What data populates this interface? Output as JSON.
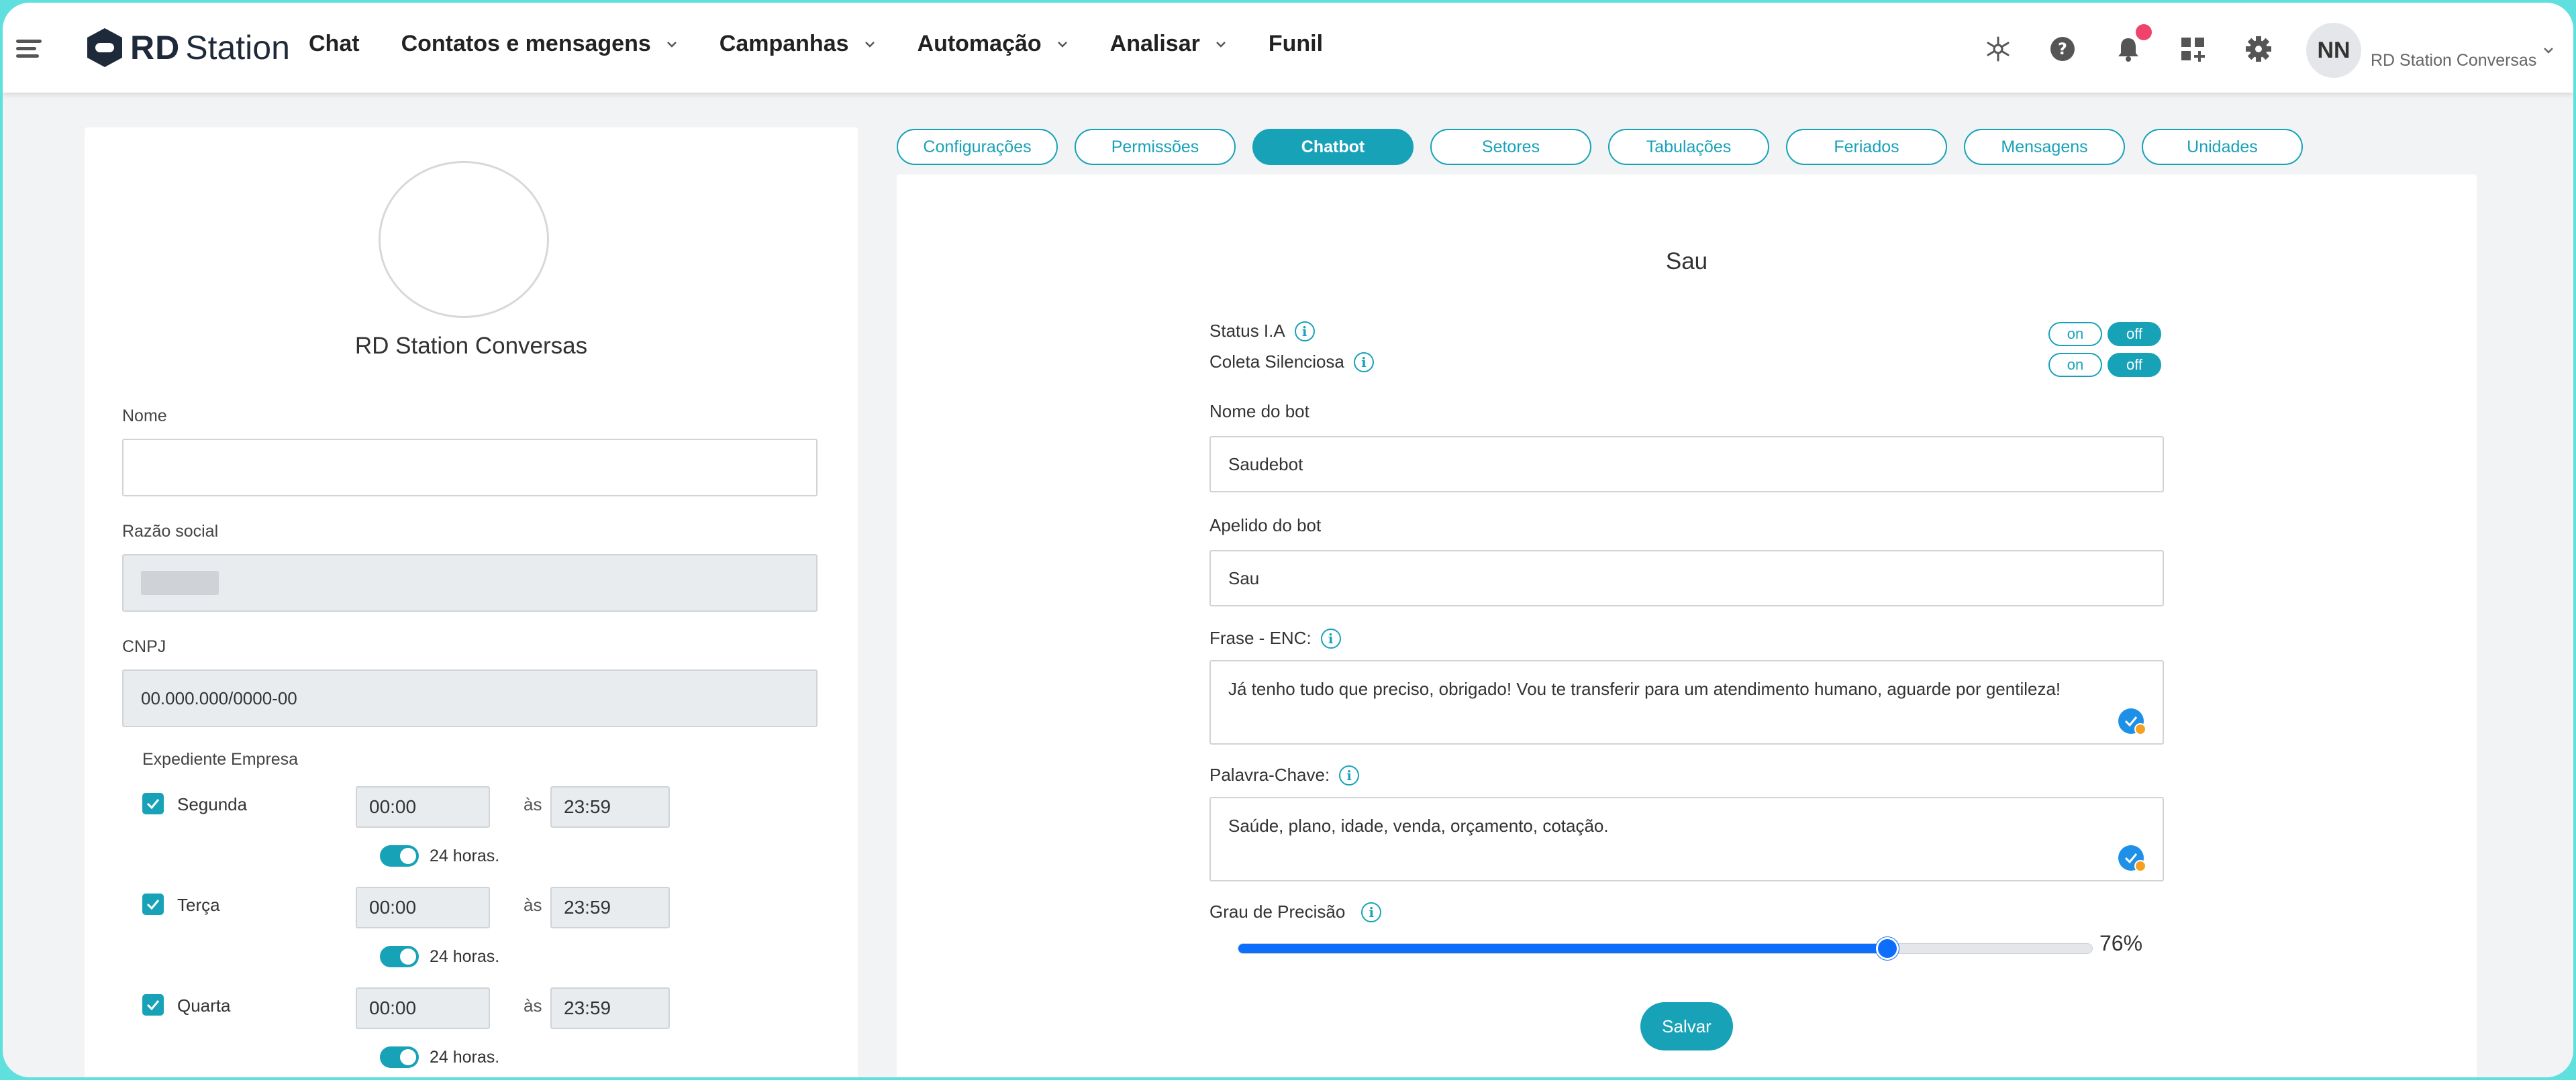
{
  "topbar": {
    "logo_rd": "RD",
    "logo_station": "Station",
    "nav": [
      {
        "label": "Chat",
        "dropdown": false
      },
      {
        "label": "Contatos e mensagens",
        "dropdown": true
      },
      {
        "label": "Campanhas",
        "dropdown": true
      },
      {
        "label": "Automação",
        "dropdown": true
      },
      {
        "label": "Analisar",
        "dropdown": true
      },
      {
        "label": "Funil",
        "dropdown": false
      }
    ],
    "avatar_initials": "NN",
    "account_name": "RD Station Conversas",
    "icons": [
      "integrations-icon",
      "help-icon",
      "bell-icon",
      "add-app-icon",
      "gear-icon"
    ],
    "notification_color": "#f0436b"
  },
  "company": {
    "name": "RD Station Conversas",
    "fields": {
      "nome": {
        "label": "Nome",
        "value": ""
      },
      "razao": {
        "label": "Razão social",
        "value": ""
      },
      "cnpj": {
        "label": "CNPJ",
        "value": "00.000.000/0000-00"
      }
    },
    "schedule_label": "Expediente Empresa",
    "separator": "às",
    "full_day_label": "24 horas.",
    "days": [
      {
        "name": "Segunda",
        "start": "00:00",
        "end": "23:59",
        "checked": true,
        "full_day": true
      },
      {
        "name": "Terça",
        "start": "00:00",
        "end": "23:59",
        "checked": true,
        "full_day": true
      },
      {
        "name": "Quarta",
        "start": "00:00",
        "end": "23:59",
        "checked": true,
        "full_day": true
      }
    ]
  },
  "tabs": [
    {
      "label": "Configurações",
      "active": false
    },
    {
      "label": "Permissões",
      "active": false
    },
    {
      "label": "Chatbot",
      "active": true
    },
    {
      "label": "Setores",
      "active": false
    },
    {
      "label": "Tabulações",
      "active": false
    },
    {
      "label": "Feriados",
      "active": false
    },
    {
      "label": "Mensagens",
      "active": false
    },
    {
      "label": "Unidades",
      "active": false
    }
  ],
  "chatbot": {
    "title": "Sau",
    "status_ia": {
      "label": "Status I.A",
      "on": "on",
      "off": "off"
    },
    "coleta": {
      "label": "Coleta Silenciosa",
      "on": "on",
      "off": "off"
    },
    "bot_name": {
      "label": "Nome do bot",
      "value": "Saudebot"
    },
    "bot_nick": {
      "label": "Apelido do bot",
      "value": "Sau"
    },
    "frase": {
      "label": "Frase - ENC:",
      "value": "Já tenho tudo que preciso, obrigado! Vou te transferir para um atendimento humano, aguarde por gentileza!"
    },
    "palavra": {
      "label": "Palavra-Chave:",
      "value": "Saúde, plano, idade, venda, orçamento, cotação."
    },
    "precision": {
      "label": "Grau de Precisão",
      "value": 76,
      "display": "76%"
    },
    "save_label": "Salvar"
  },
  "colors": {
    "accent": "#17a2b8",
    "slider": "#0d6efd",
    "frame": "#5fe0df"
  }
}
